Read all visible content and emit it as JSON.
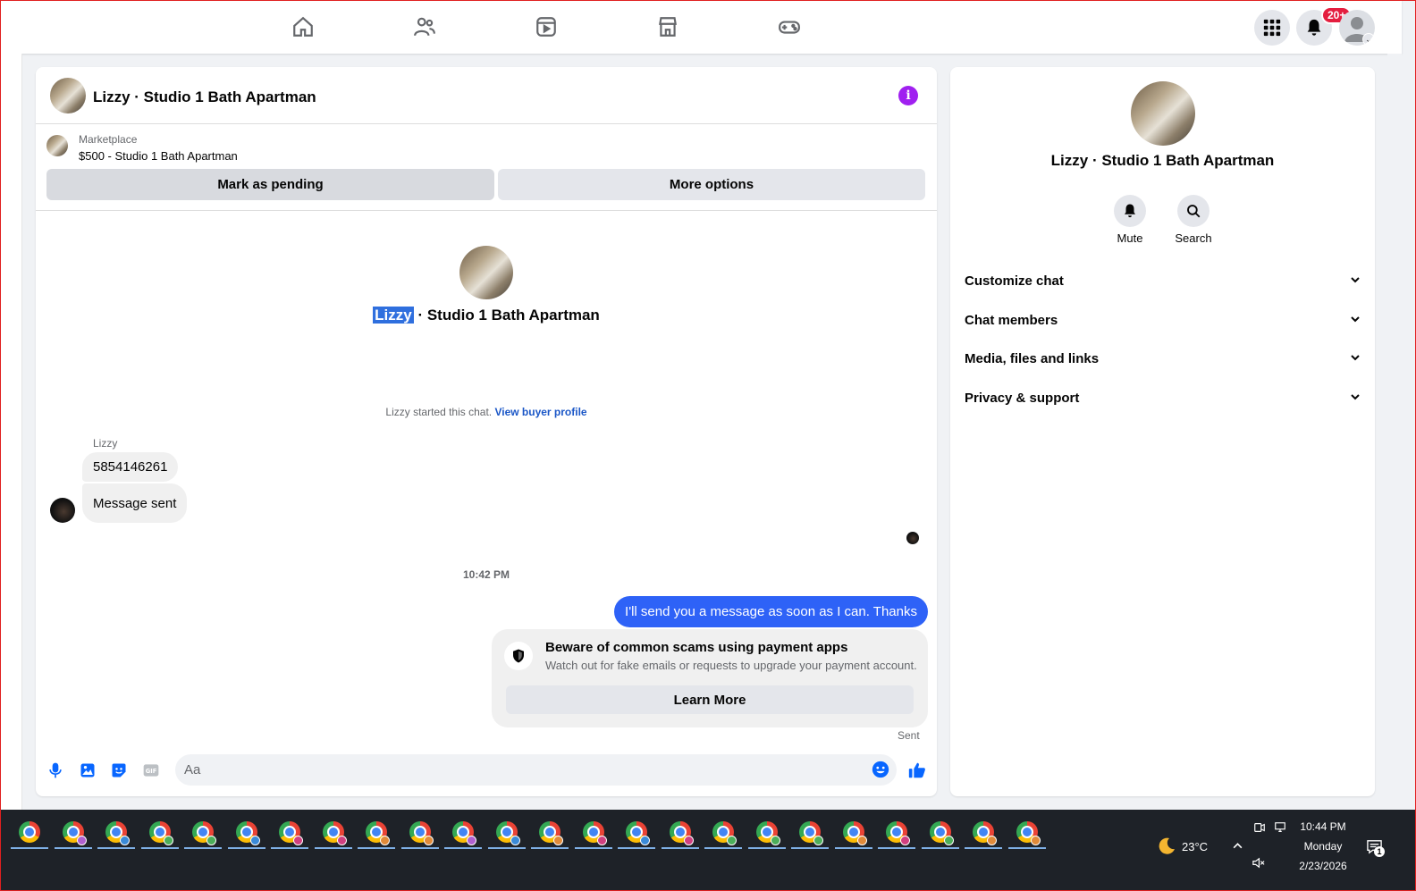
{
  "chat": {
    "title": "Lizzy · Studio 1 Bath Apartman",
    "marketplace_label": "Marketplace",
    "listing": "$500 - Studio 1 Bath Apartman",
    "mark_pending": "Mark as pending",
    "more_options": "More options",
    "center_name_highlight": "Lizzy",
    "center_name_rest": " · Studio 1 Bath Apartman",
    "started_text": "Lizzy started this chat. ",
    "view_buyer": "View buyer profile",
    "sender": "Lizzy",
    "messages_in": [
      "5854146261",
      "Message sent"
    ],
    "time": "10:42 PM",
    "message_out": "I'll send you a message as soon as I can. Thanks",
    "scam_title": "Beware of common scams using payment apps",
    "scam_desc": "Watch out for fake emails or requests to upgrade your payment account.",
    "learn_more": "Learn More",
    "sent": "Sent",
    "composer_placeholder": "Aa"
  },
  "side": {
    "name": "Lizzy · Studio 1 Bath Apartman",
    "mute": "Mute",
    "search": "Search",
    "sections": [
      "Customize chat",
      "Chat members",
      "Media, files and links",
      "Privacy & support"
    ]
  },
  "top": {
    "badge": "20+"
  },
  "taskbar": {
    "temperature": "23°C",
    "time": "10:44 PM",
    "day": "Monday",
    "date": "2/23/2026",
    "notif_count": "1",
    "profile_colors": [
      "#e08a3a",
      "#b060d0",
      "#3a8ad8",
      "#4cae5a",
      "#4cae5a",
      "#3a8ad8",
      "#d04080",
      "#d04080",
      "#e08a3a",
      "#e08a3a",
      "#b060d0",
      "#3a8ad8",
      "#e08a3a",
      "#d04080",
      "#3a8ad8",
      "#d04080",
      "#4cae5a",
      "#4cae5a",
      "#4cae5a",
      "#e08a3a",
      "#d04080",
      "#4cae5a",
      "#e08a3a",
      "#e08a3a"
    ]
  },
  "colors": {
    "accent_blue": "#2e62f7",
    "info_purple": "#a020f0",
    "badge_red": "#e41e3f"
  }
}
